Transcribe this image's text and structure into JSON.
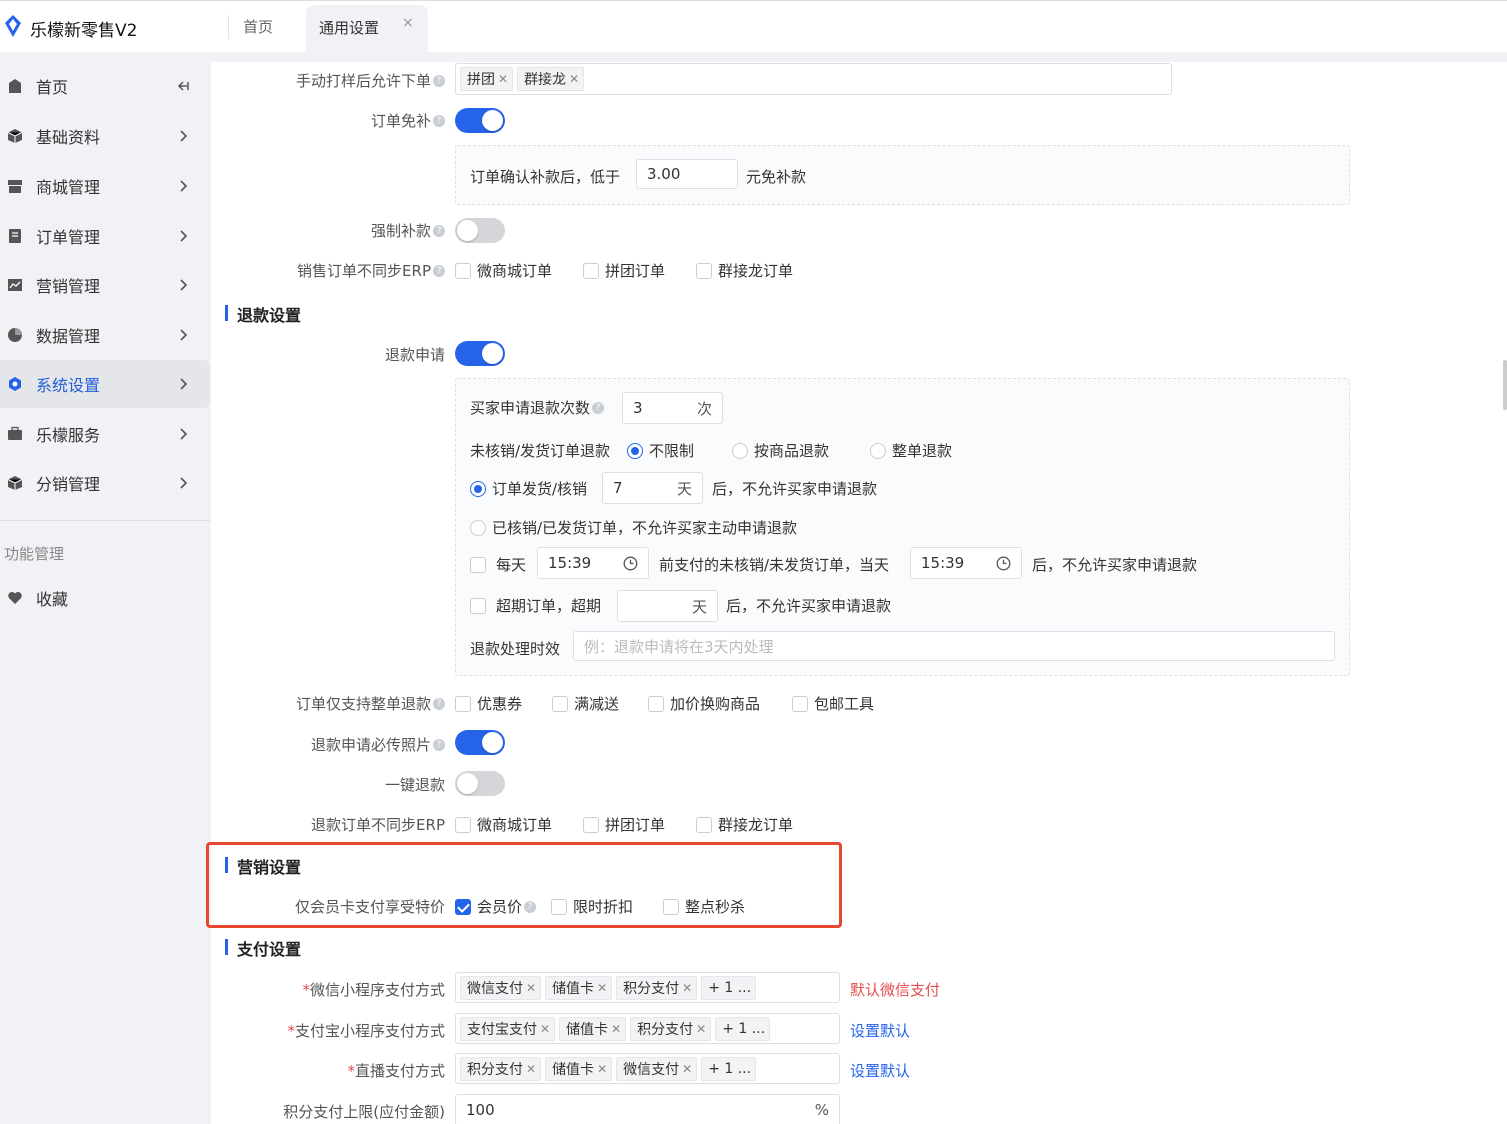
{
  "app": {
    "title": "乐檬新零售V2"
  },
  "tabs": {
    "home": "首页",
    "general": "通用设置",
    "close": "×"
  },
  "sidebar": {
    "items": [
      {
        "label": "首页",
        "icon": "home-icon"
      },
      {
        "label": "基础资料",
        "icon": "cube-icon"
      },
      {
        "label": "商城管理",
        "icon": "store-icon"
      },
      {
        "label": "订单管理",
        "icon": "order-icon"
      },
      {
        "label": "营销管理",
        "icon": "chart-icon"
      },
      {
        "label": "数据管理",
        "icon": "pie-icon"
      },
      {
        "label": "系统设置",
        "icon": "settings-icon",
        "active": true
      },
      {
        "label": "乐檬服务",
        "icon": "briefcase-icon"
      },
      {
        "label": "分销管理",
        "icon": "cube-icon"
      }
    ],
    "section_label": "功能管理",
    "favorites": "收藏"
  },
  "order": {
    "manual_sample_label": "手动打样后允许下单",
    "manual_sample_tags": [
      "拼团",
      "群接龙"
    ],
    "exempt_label": "订单免补",
    "exempt_on": true,
    "exempt_prefix": "订单确认补款后，低于",
    "exempt_value": "3.00",
    "exempt_suffix": "元免补款",
    "force_label": "强制补款",
    "force_on": false,
    "no_sync_label": "销售订单不同步ERP",
    "no_sync_options": [
      "微商城订单",
      "拼团订单",
      "群接龙订单"
    ]
  },
  "refund": {
    "section_title": "退款设置",
    "apply_label": "退款申请",
    "apply_on": true,
    "times_label": "买家申请退款次数",
    "times_value": "3",
    "times_unit": "次",
    "unverified_label": "未核销/发货订单退款",
    "unverified_options": [
      "不限制",
      "按商品退款",
      "整单退款"
    ],
    "after_ship_label": "订单发货/核销",
    "after_ship_value": "7",
    "day_unit": "天",
    "after_ship_suffix": "后，不允许买家申请退款",
    "verified_label": "已核销/已发货订单，不允许买家主动申请退款",
    "daily_label": "每天",
    "daily_time": "15:39",
    "daily_middle": "前支付的未核销/未发货订单，当天",
    "daily_time2": "15:39",
    "daily_suffix": "后，不允许买家申请退款",
    "expired_label": "超期订单，超期",
    "expired_suffix": "后，不允许买家申请退款",
    "timeliness_label": "退款处理时效",
    "timeliness_placeholder": "例：退款申请将在3天内处理",
    "whole_only_label": "订单仅支持整单退款",
    "whole_only_options": [
      "优惠券",
      "满减送",
      "加价换购商品",
      "包邮工具"
    ],
    "photo_label": "退款申请必传照片",
    "photo_on": true,
    "one_click_label": "一键退款",
    "one_click_on": false,
    "no_sync_label": "退款订单不同步ERP",
    "no_sync_options": [
      "微商城订单",
      "拼团订单",
      "群接龙订单"
    ]
  },
  "marketing": {
    "section_title": "营销设置",
    "member_label": "仅会员卡支付享受特价",
    "member_options": [
      "会员价",
      "限时折扣",
      "整点秒杀"
    ]
  },
  "payment": {
    "section_title": "支付设置",
    "required_mark": "*",
    "wechat_label": "微信小程序支付方式",
    "wechat_tags": [
      "微信支付",
      "储值卡",
      "积分支付"
    ],
    "wechat_more": "+ 1 ...",
    "wechat_link": "默认微信支付",
    "alipay_label": "支付宝小程序支付方式",
    "alipay_tags": [
      "支付宝支付",
      "储值卡",
      "积分支付"
    ],
    "alipay_more": "+ 1 ...",
    "alipay_link": "设置默认",
    "live_label": "直播支付方式",
    "live_tags": [
      "积分支付",
      "储值卡",
      "微信支付"
    ],
    "live_more": "+ 1 ...",
    "live_link": "设置默认",
    "points_label": "积分支付上限(应付金额)",
    "points_value": "100",
    "points_unit": "%"
  },
  "colors": {
    "accent": "#2563eb",
    "danger": "#e34d4d",
    "highlight": "#e5472f"
  }
}
